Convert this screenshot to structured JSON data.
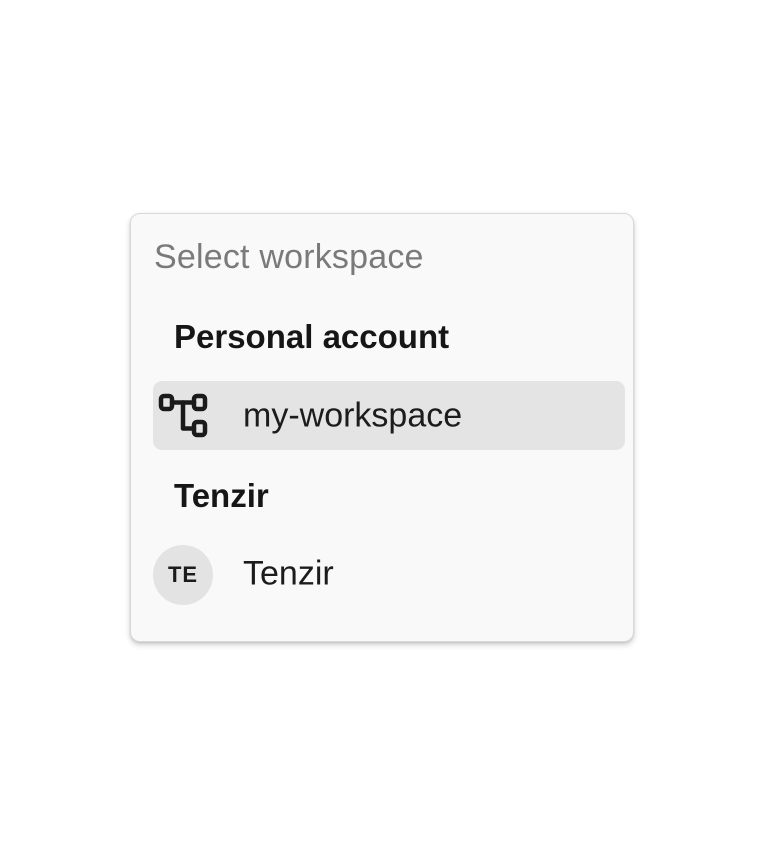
{
  "popover": {
    "title": "Select workspace",
    "groups": [
      {
        "heading": "Personal account",
        "items": [
          {
            "label": "my-workspace",
            "icon": "workspace-tree-icon",
            "selected": true
          }
        ]
      },
      {
        "heading": "Tenzir",
        "items": [
          {
            "label": "Tenzir",
            "avatar_initials": "TE",
            "selected": false
          }
        ]
      }
    ]
  },
  "colors": {
    "panel_background": "#f9f9f9",
    "selected_background": "#e4e4e4",
    "avatar_background": "#e3e3e3",
    "title_text": "#7a7a7a"
  }
}
